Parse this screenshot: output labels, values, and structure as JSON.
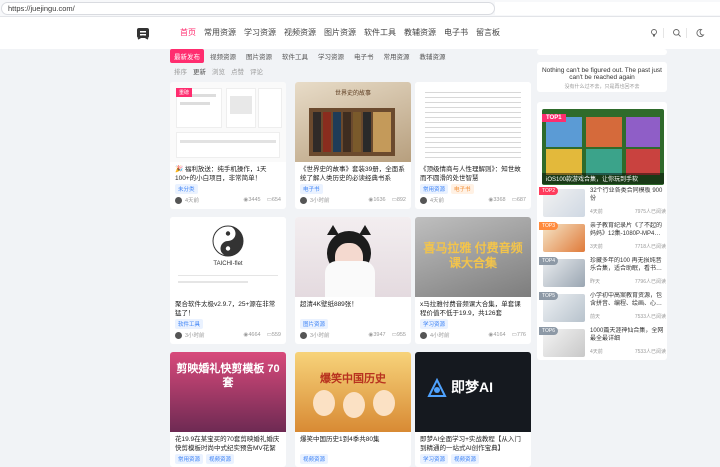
{
  "browser": {
    "url": "https://juejingu.com/"
  },
  "header": {
    "logo_text": "掘",
    "nav": [
      "首页",
      "常用资源",
      "学习资源",
      "视频资源",
      "图片资源",
      "软件工具",
      "教辅资源",
      "电子书",
      "留言板"
    ]
  },
  "categories": [
    "最新发布",
    "视频资源",
    "图片资源",
    "软件工具",
    "学习资源",
    "电子书",
    "常用资源",
    "教辅资源"
  ],
  "sort": [
    "排序",
    "更新",
    "浏览",
    "点赞",
    "评论"
  ],
  "cards": [
    {
      "title": "🎉 福利放送：纯手机操作，1天100+的小白项目，非常简单！",
      "tags": [
        "未分类"
      ],
      "time": "4天前",
      "views": "3445",
      "comments": "654",
      "thumb_text": "重磅"
    },
    {
      "title": "《世界史的故事》套装39册，全面系统了解人类历史的必读经典书系",
      "tags": [
        "电子书"
      ],
      "time": "3小时前",
      "views": "1636",
      "comments": "892",
      "thumb_text": "世界史的故事"
    },
    {
      "title": "《顶级情商与人性理解则》：知世故而不圆滑的处世智慧",
      "tags": [
        "常用资源",
        "电子书"
      ],
      "time": "4天前",
      "views": "3368",
      "comments": "687",
      "thumb_text": ""
    },
    {
      "title": "聚合软件太极v2.9.7，25+源在非常猛了！",
      "tags": [
        "软件工具"
      ],
      "time": "3小时前",
      "views": "4664",
      "comments": "559",
      "thumb_text": "TAICHI-flet"
    },
    {
      "title": "超清4K壁纸889张！",
      "tags": [
        "图片资源"
      ],
      "time": "3小时前",
      "views": "3947",
      "comments": "955",
      "thumb_text": ""
    },
    {
      "title": "x马拉雅付费音频课大合集，单套课程价值不低于19.9，共126套",
      "tags": [
        "学习资源"
      ],
      "time": "4小时前",
      "views": "4164",
      "comments": "776",
      "thumb_text": "喜马拉雅 付费音频课大合集"
    },
    {
      "title": "花19.9在某宝买的70套剪映婚礼婚庆快剪模板时尚中式纪实预告MV花絮视频",
      "tags": [
        "常用资源",
        "视频资源"
      ],
      "time": "",
      "views": "",
      "comments": "",
      "thumb_text": "剪映婚礼快剪模板 70套"
    },
    {
      "title": "爆笑中国历史1到4季共80集",
      "tags": [
        "视频资源"
      ],
      "time": "",
      "views": "",
      "comments": "",
      "thumb_text": "爆笑中国历史"
    },
    {
      "title": "即梦AI全面学习+实战教程【从入门到精通的一站式AI创作宝典】",
      "tags": [
        "学习资源",
        "视频资源"
      ],
      "time": "",
      "views": "",
      "comments": "",
      "thumb_text": "即梦AI"
    }
  ],
  "sidebar": {
    "quote_en": "Nothing can't be figured out. The past just can't be reached again",
    "quote_cn": "没有什么过不去，只是再也回不去",
    "hot_badge": "TOP1",
    "hot_banner": "iOS100款游戏合集，让你玩到手软",
    "hot": [
      {
        "rank": "TOP2",
        "title": "32个行业各类合同模板 900份",
        "time": "4天前",
        "views": "7975人已阅读"
      },
      {
        "rank": "TOP3",
        "title": "亲子教育纪录片《了不起的妈妈》12集-1080P-MP4…",
        "time": "3天前",
        "views": "7718人已阅读"
      },
      {
        "rank": "TOP4",
        "title": "珍藏多年的100 再无损纯音乐合集，适合助眠，看书…",
        "time": "昨天",
        "views": "7796人已阅读"
      },
      {
        "rank": "TOP5",
        "title": "小学初中高案教育资源，包含拼音、编程、绘画、心…",
        "time": "前天",
        "views": "7533人已阅读"
      },
      {
        "rank": "TOP6",
        "title": "1000篇天涯神仙合集，全网最全最详细",
        "time": "4天前",
        "views": "7533人已阅读"
      }
    ]
  },
  "colors": {
    "accent": "#ff2d6f",
    "tag_blue": "#3b82f6",
    "tag_orange": "#f28a2e"
  }
}
